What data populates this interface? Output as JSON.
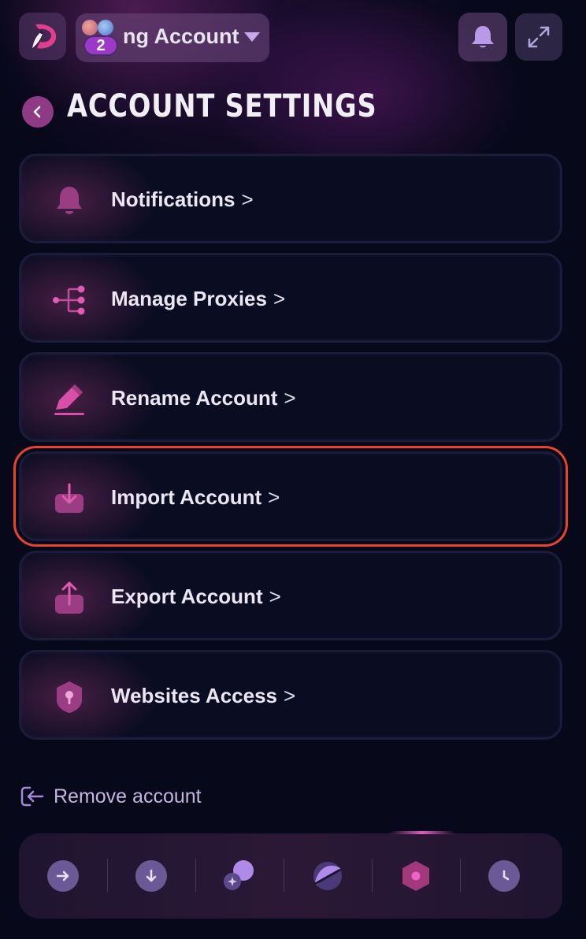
{
  "header": {
    "account_name": "ng Account",
    "account_count": "2",
    "icons": [
      "app-logo",
      "avatar-red",
      "avatar-blue",
      "caret-down-icon",
      "bell-icon",
      "expand-icon"
    ]
  },
  "page": {
    "title": "ACCOUNT SETTINGS"
  },
  "menu": {
    "items": [
      {
        "label": "Notifications",
        "icon": "bell-icon"
      },
      {
        "label": "Manage Proxies",
        "icon": "proxy-tree-icon"
      },
      {
        "label": "Rename Account",
        "icon": "pencil-icon"
      },
      {
        "label": "Import Account",
        "icon": "import-icon",
        "highlighted": true
      },
      {
        "label": "Export Account",
        "icon": "export-icon"
      },
      {
        "label": "Websites Access",
        "icon": "shield-key-icon"
      }
    ],
    "chevron": ">"
  },
  "remove": {
    "label": "Remove account"
  },
  "bottom_nav": {
    "items": [
      "send-icon",
      "receive-icon",
      "swap-icon",
      "staking-icon",
      "settings-icon",
      "history-icon"
    ],
    "active": "settings-icon"
  },
  "colors": {
    "background": "#07081a",
    "accent_pink": "#e25bbd",
    "highlight_border": "#e8432f",
    "nav_icon": "#6b5896"
  }
}
